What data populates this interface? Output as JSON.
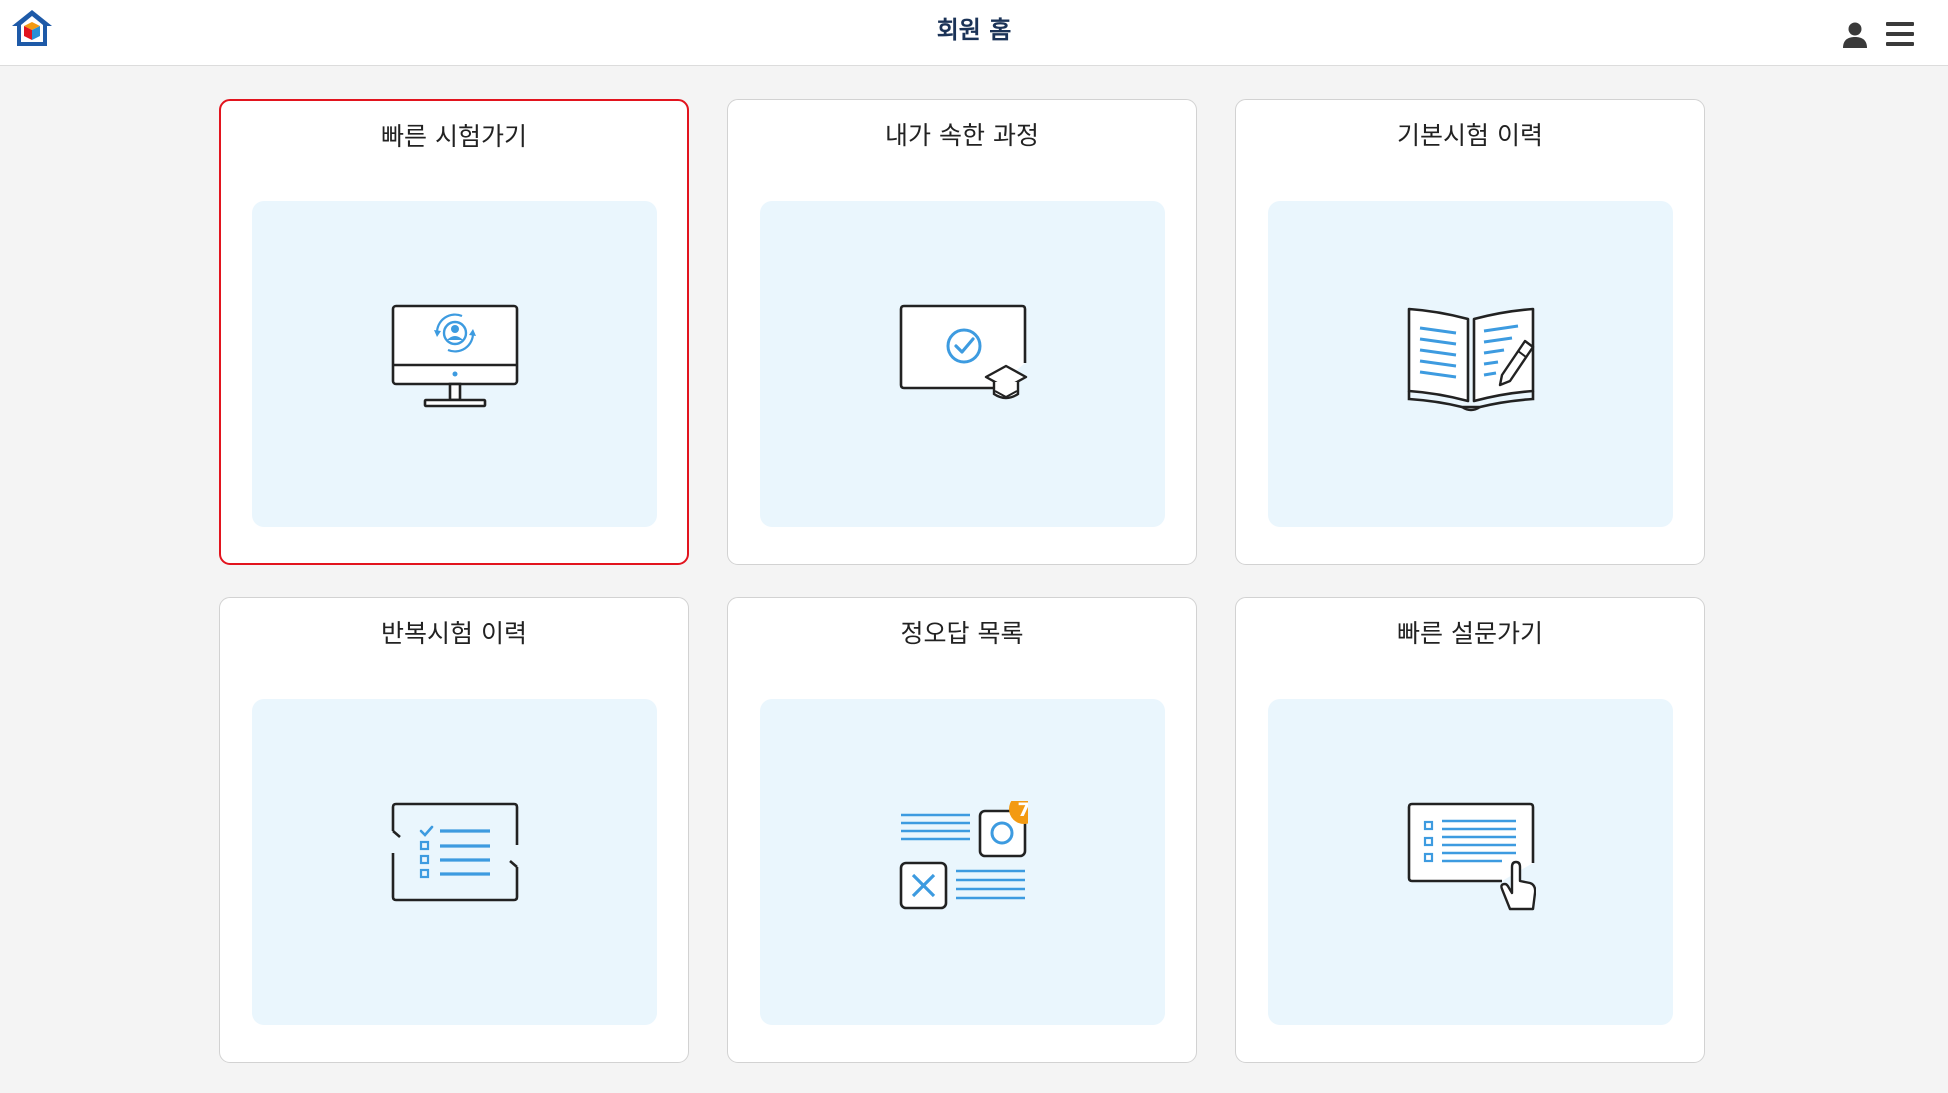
{
  "header": {
    "title": "회원 홈",
    "logo_icon": "home-logo-icon",
    "user_icon": "user-icon",
    "menu_icon": "hamburger-menu-icon"
  },
  "colors": {
    "accent_blue": "#3d9be0",
    "selected_border": "#e2141e",
    "badge_orange": "#f39a12",
    "illustration_bg": "#eaf6fd"
  },
  "cards": [
    {
      "title": "빠른 시험가기",
      "icon": "monitor-user-icon",
      "selected": true
    },
    {
      "title": "내가 속한 과정",
      "icon": "course-check-icon",
      "selected": false
    },
    {
      "title": "기본시험 이력",
      "icon": "book-pencil-icon",
      "selected": false
    },
    {
      "title": "반복시험 이력",
      "icon": "checklist-icon",
      "selected": false
    },
    {
      "title": "정오답 목록",
      "icon": "ox-list-icon",
      "selected": false,
      "badge": "7"
    },
    {
      "title": "빠른 설문가기",
      "icon": "survey-click-icon",
      "selected": false
    }
  ]
}
